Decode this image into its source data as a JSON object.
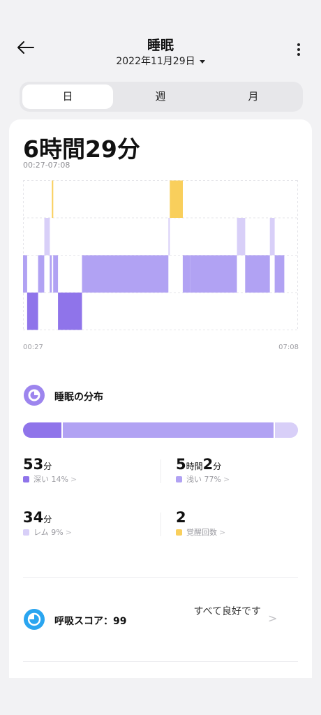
{
  "header": {
    "title": "睡眠",
    "date": "2022年11月29日"
  },
  "tabs": [
    "日",
    "週",
    "月"
  ],
  "summary": {
    "total_duration": "6時間29分",
    "time_range": "00:27-07:08"
  },
  "chart_data": {
    "type": "hypnogram",
    "time_start": "00:27",
    "time_end": "07:08",
    "stages": [
      "覚醒",
      "レム",
      "浅い",
      "深い"
    ],
    "segments": [
      {
        "start_min": 0,
        "end_min": 6,
        "stage": "浅い"
      },
      {
        "start_min": 6,
        "end_min": 22,
        "stage": "深い"
      },
      {
        "start_min": 22,
        "end_min": 31,
        "stage": "浅い"
      },
      {
        "start_min": 31,
        "end_min": 39,
        "stage": "レム"
      },
      {
        "start_min": 39,
        "end_min": 42,
        "stage": "浅い"
      },
      {
        "start_min": 42,
        "end_min": 44,
        "stage": "覚醒"
      },
      {
        "start_min": 44,
        "end_min": 51,
        "stage": "浅い"
      },
      {
        "start_min": 51,
        "end_min": 86,
        "stage": "深い"
      },
      {
        "start_min": 86,
        "end_min": 212,
        "stage": "浅い"
      },
      {
        "start_min": 212,
        "end_min": 214,
        "stage": "レム"
      },
      {
        "start_min": 214,
        "end_min": 233,
        "stage": "覚醒"
      },
      {
        "start_min": 233,
        "end_min": 244,
        "stage": "浅い"
      },
      {
        "start_min": 244,
        "end_min": 312,
        "stage": "浅い"
      },
      {
        "start_min": 312,
        "end_min": 324,
        "stage": "レム"
      },
      {
        "start_min": 324,
        "end_min": 360,
        "stage": "浅い"
      },
      {
        "start_min": 360,
        "end_min": 367,
        "stage": "レム"
      },
      {
        "start_min": 367,
        "end_min": 381,
        "stage": "浅い"
      }
    ]
  },
  "distribution": {
    "title": "睡眠の分布",
    "shares": {
      "deep": 14,
      "light": 77,
      "rem": 9
    },
    "stats": [
      {
        "value": "53",
        "unit": "分",
        "label": "深い 14%",
        "color": "#8f74ea"
      },
      {
        "value_h": "5",
        "unit_h": "時間",
        "value_m": "2",
        "unit_m": "分",
        "label": "浅い 77%",
        "color": "#b1a2f3"
      },
      {
        "value": "34",
        "unit": "分",
        "label": "レム 9%",
        "color": "#d8cff8"
      },
      {
        "value": "2",
        "unit": "",
        "label": "覚醒回数",
        "color": "#f9cf5c"
      }
    ]
  },
  "breathing": {
    "title": "呼吸スコア：99",
    "status": "すべて良好です"
  },
  "colors": {
    "deep": "#8f74ea",
    "light": "#b1a2f3",
    "rem": "#d8cff8",
    "awake": "#f9cf5c",
    "breathing_icon": "#2aa5f0"
  }
}
